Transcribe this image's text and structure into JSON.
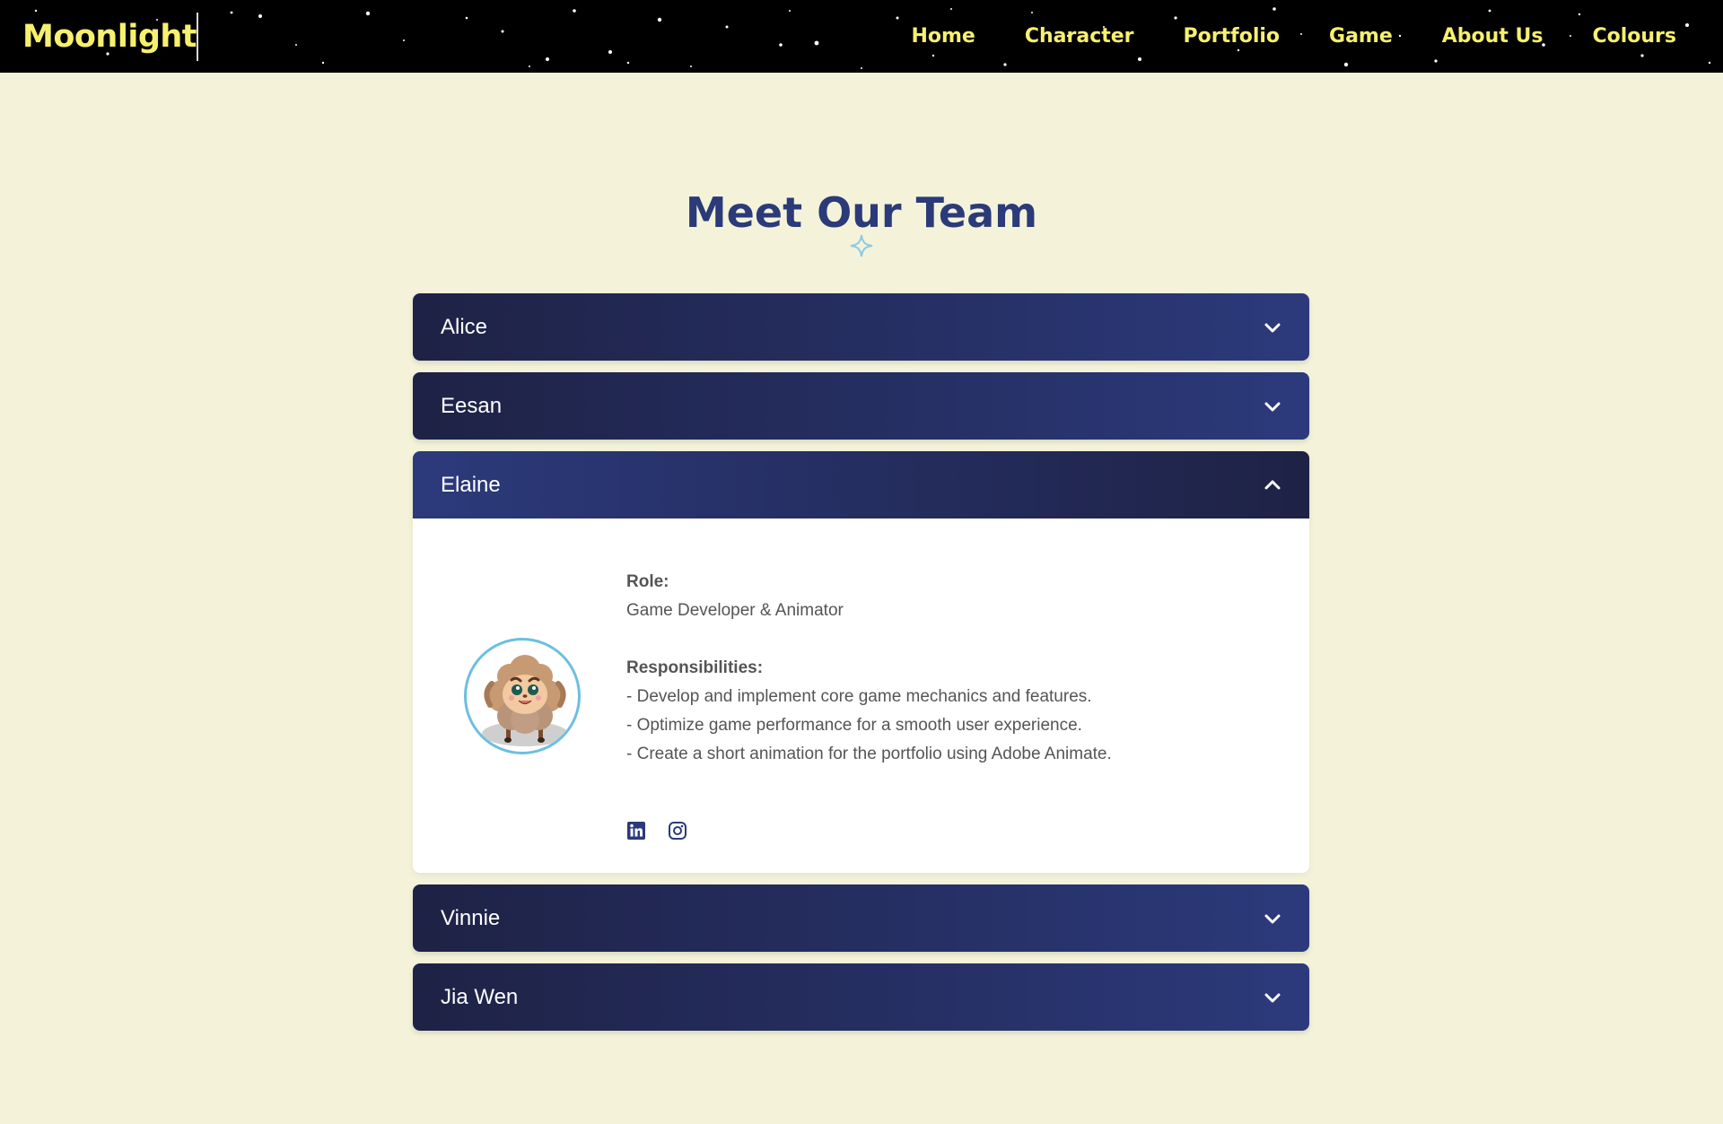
{
  "nav": {
    "brand": "Moonlight",
    "links": [
      "Home",
      "Character",
      "Portfolio",
      "Game",
      "About Us",
      "Colours"
    ]
  },
  "main": {
    "title": "Meet Our Team",
    "members": [
      {
        "name": "Alice",
        "expanded": false
      },
      {
        "name": "Eesan",
        "expanded": false
      },
      {
        "name": "Elaine",
        "expanded": true
      },
      {
        "name": "Vinnie",
        "expanded": false
      },
      {
        "name": "Jia Wen",
        "expanded": false
      }
    ],
    "detail": {
      "role_label": "Role:",
      "role": "Game Developer & Animator",
      "resp_label": "Responsibilities:",
      "responsibilities": [
        "- Develop and implement core game mechanics and features.",
        "- Optimize game performance for a smooth user experience.",
        "- Create a short animation for the portfolio using Adobe Animate."
      ]
    }
  },
  "colors": {
    "nav_text": "#f7f06e",
    "title": "#2b3a78",
    "page_bg": "#f4f3da",
    "accordion_dark": "#1e2245",
    "accordion_light": "#2c3a7c",
    "avatar_ring": "#6cbfe0"
  },
  "icons": {
    "expand": "chevron-down-icon",
    "collapse": "chevron-up-icon",
    "social": [
      "linkedin-icon",
      "instagram-icon"
    ],
    "title_decoration": "sparkle-icon"
  }
}
